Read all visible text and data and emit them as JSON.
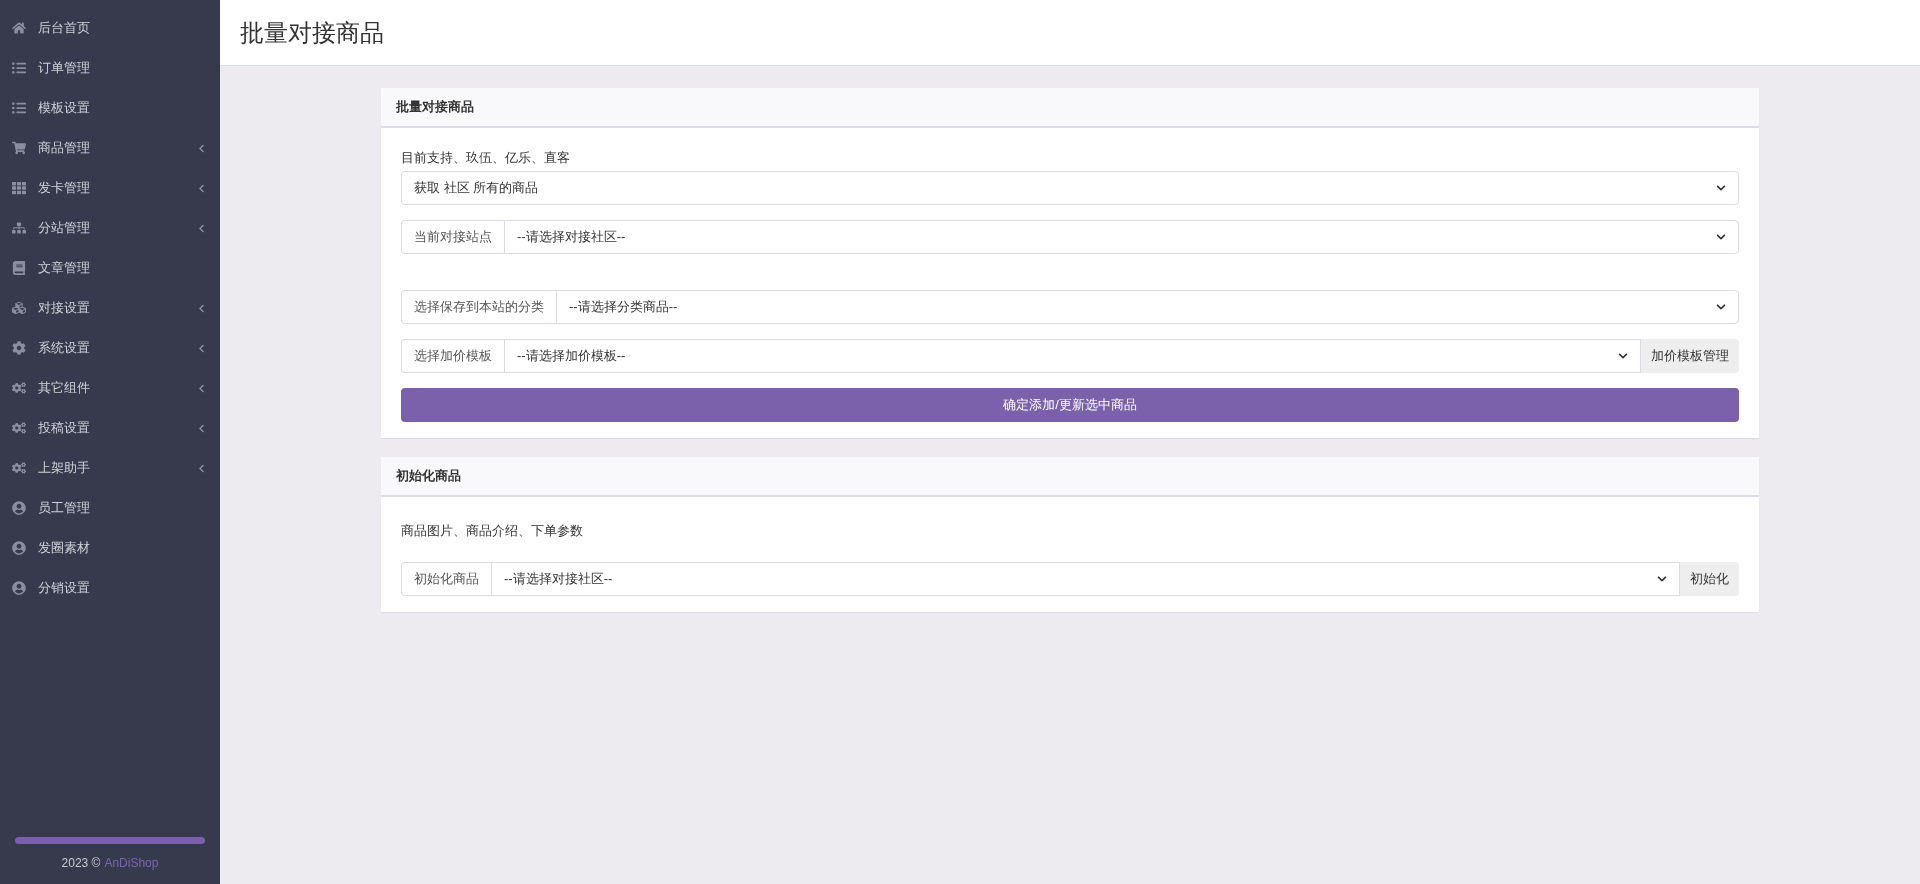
{
  "sidebar": {
    "items": [
      {
        "label": "后台首页",
        "has_submenu": false
      },
      {
        "label": "订单管理",
        "has_submenu": false
      },
      {
        "label": "模板设置",
        "has_submenu": false
      },
      {
        "label": "商品管理",
        "has_submenu": true
      },
      {
        "label": "发卡管理",
        "has_submenu": true
      },
      {
        "label": "分站管理",
        "has_submenu": true
      },
      {
        "label": "文章管理",
        "has_submenu": false
      },
      {
        "label": "对接设置",
        "has_submenu": true
      },
      {
        "label": "系统设置",
        "has_submenu": true
      },
      {
        "label": "其它组件",
        "has_submenu": true
      },
      {
        "label": "投稿设置",
        "has_submenu": true
      },
      {
        "label": "上架助手",
        "has_submenu": true
      },
      {
        "label": "员工管理",
        "has_submenu": false
      },
      {
        "label": "发圈素材",
        "has_submenu": false
      },
      {
        "label": "分销设置",
        "has_submenu": false
      }
    ],
    "footer": {
      "year": "2023 ©",
      "brand": "AnDiShop"
    }
  },
  "page_title": "批量对接商品",
  "batch_card": {
    "title": "批量对接商品",
    "note": "目前支持、玖伍、亿乐、直客",
    "fetch_select": "获取 社区 所有的商品",
    "station": {
      "label": "当前对接站点",
      "value": "--请选择对接社区--"
    },
    "category": {
      "label": "选择保存到本站的分类",
      "value": "--请选择分类商品--"
    },
    "template": {
      "label": "选择加价模板",
      "value": "--请选择加价模板--",
      "button": "加价模板管理"
    },
    "submit": "确定添加/更新选中商品"
  },
  "init_card": {
    "title": "初始化商品",
    "note": "商品图片、商品介绍、下单参数",
    "group": {
      "label": "初始化商品",
      "value": "--请选择对接社区--",
      "button": "初始化"
    }
  }
}
